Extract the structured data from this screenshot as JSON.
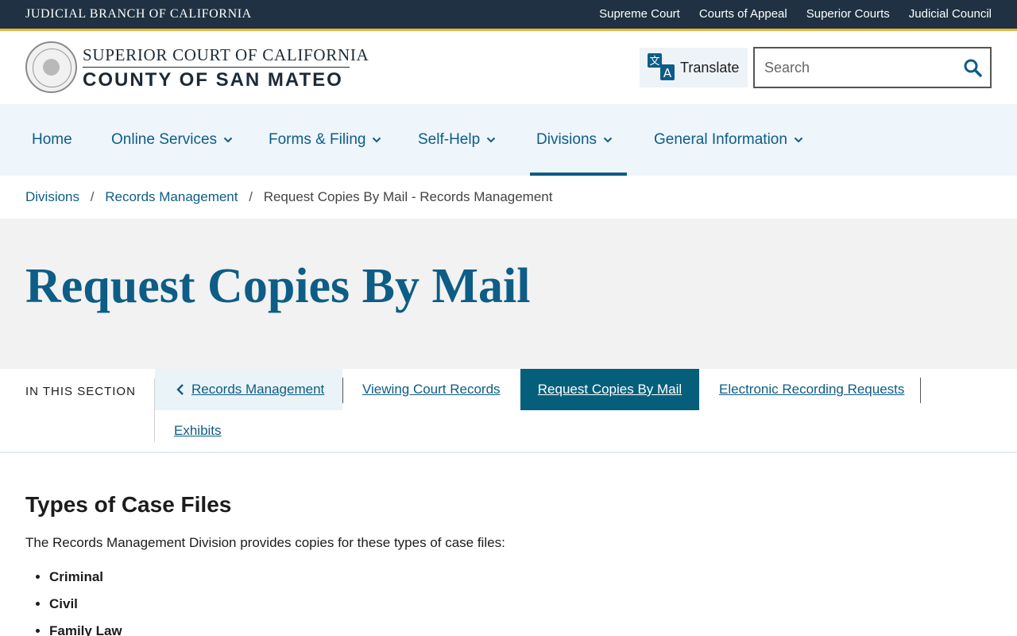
{
  "topbar": {
    "brand": "JUDICIAL BRANCH OF CALIFORNIA",
    "links": [
      "Supreme Court",
      "Courts of Appeal",
      "Superior Courts",
      "Judicial Council"
    ]
  },
  "header": {
    "court_line_1": "SUPERIOR COURT OF CALIFORNIA",
    "court_line_2": "COUNTY OF SAN MATEO",
    "translate_label": "Translate",
    "search_placeholder": "Search"
  },
  "nav": {
    "items": [
      {
        "label": "Home",
        "dropdown": false
      },
      {
        "label": "Online Services",
        "dropdown": true
      },
      {
        "label": "Forms & Filing",
        "dropdown": true
      },
      {
        "label": "Self-Help",
        "dropdown": true
      },
      {
        "label": "Divisions",
        "dropdown": true,
        "active": true
      },
      {
        "label": "General Information",
        "dropdown": true
      }
    ]
  },
  "breadcrumb": {
    "items": [
      "Divisions",
      "Records Management"
    ],
    "separator": "/",
    "current": "Request Copies By Mail - Records Management"
  },
  "hero": {
    "title": "Request Copies By Mail"
  },
  "section_nav": {
    "heading": "IN THIS SECTION",
    "back_label": "Records Management",
    "links": [
      "Viewing Court Records",
      "Request Copies By Mail",
      "Electronic Recording Requests",
      "Exhibits"
    ],
    "active": "Request Copies By Mail"
  },
  "content": {
    "heading": "Types of Case Files",
    "intro": "The Records Management Division provides copies for these types of case files:",
    "case_types": [
      "Criminal",
      "Civil",
      "Family Law"
    ]
  },
  "colors": {
    "topbar": "#1f3142",
    "gold": "#e7b73a",
    "link": "#0d5d86",
    "active_tab": "#055f7b",
    "nav_bg": "#eef5fb",
    "hero_bg": "#f2f2f2"
  }
}
